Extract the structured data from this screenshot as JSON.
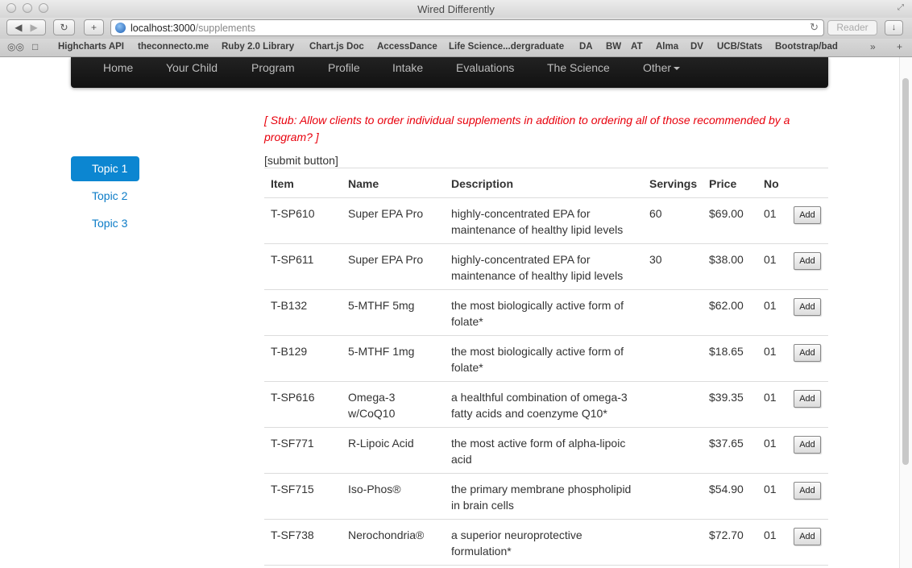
{
  "window": {
    "title": "Wired Differently"
  },
  "browser": {
    "url_host": "localhost:3000",
    "url_path": "/supplements",
    "reader_label": "Reader",
    "bookmarks": [
      "Highcharts API",
      "theconnecto.me",
      "Ruby 2.0 Library",
      "Chart.js Doc",
      "AccessDance",
      "Life Science...dergraduate",
      "DA",
      "BW",
      "AT",
      "Alma",
      "DV",
      "UCB/Stats",
      "Bootstrap/bad"
    ]
  },
  "navbar": {
    "items": [
      "Home",
      "Your Child",
      "Program",
      "Profile",
      "Intake",
      "Evaluations",
      "The Science",
      "Other"
    ]
  },
  "sidebar": {
    "items": [
      {
        "label": "Topic 1",
        "active": true
      },
      {
        "label": "Topic 2",
        "active": false
      },
      {
        "label": "Topic 3",
        "active": false
      }
    ]
  },
  "main": {
    "stub_line1": "[ Stub: Allow clients to order individual supplements in addition to ordering all of those recommended by a",
    "stub_line2": "program? ]",
    "submit_placeholder": "[submit button]"
  },
  "table": {
    "headers": [
      "Item",
      "Name",
      "Description",
      "Servings",
      "Price",
      "No"
    ],
    "add_label": "Add",
    "rows": [
      {
        "item": "T-SP610",
        "name1": "Super EPA Pro",
        "name2": "",
        "desc1": "highly-concentrated EPA for",
        "desc2": "maintenance of healthy lipid levels",
        "servings": "60",
        "price": "$69.00",
        "no": "01"
      },
      {
        "item": "T-SP611",
        "name1": "Super EPA Pro",
        "name2": "",
        "desc1": "highly-concentrated EPA for",
        "desc2": "maintenance of healthy lipid levels",
        "servings": "30",
        "price": "$38.00",
        "no": "01"
      },
      {
        "item": "T-B132",
        "name1": "5-MTHF 5mg",
        "name2": "",
        "desc1": "the most biologically active form of",
        "desc2": "folate*",
        "servings": "",
        "price": "$62.00",
        "no": "01"
      },
      {
        "item": "T-B129",
        "name1": "5-MTHF 1mg",
        "name2": "",
        "desc1": "the most biologically active form of",
        "desc2": "folate*",
        "servings": "",
        "price": "$18.65",
        "no": "01"
      },
      {
        "item": "T-SP616",
        "name1": "Omega-3",
        "name2": "w/CoQ10",
        "desc1": "a healthful combination of omega-3",
        "desc2": "fatty acids and coenzyme Q10*",
        "servings": "",
        "price": "$39.35",
        "no": "01"
      },
      {
        "item": "T-SF771",
        "name1": "R-Lipoic Acid",
        "name2": "",
        "desc1": "the most active form of alpha-lipoic",
        "desc2": "acid",
        "servings": "",
        "price": "$37.65",
        "no": "01"
      },
      {
        "item": "T-SF715",
        "name1": "Iso-Phos®",
        "name2": "",
        "desc1": "the primary membrane phospholipid",
        "desc2": "in brain cells",
        "servings": "",
        "price": "$54.90",
        "no": "01"
      },
      {
        "item": "T-SF738",
        "name1": "Nerochondria®",
        "name2": "",
        "desc1": "a superior neuroprotective",
        "desc2": "formulation*",
        "servings": "",
        "price": "$72.70",
        "no": "01"
      }
    ]
  },
  "colors": {
    "accent": "#0c86d1",
    "link": "#0c7cc7",
    "stub": "#e8000c",
    "navbar": "#1a1a1a"
  }
}
